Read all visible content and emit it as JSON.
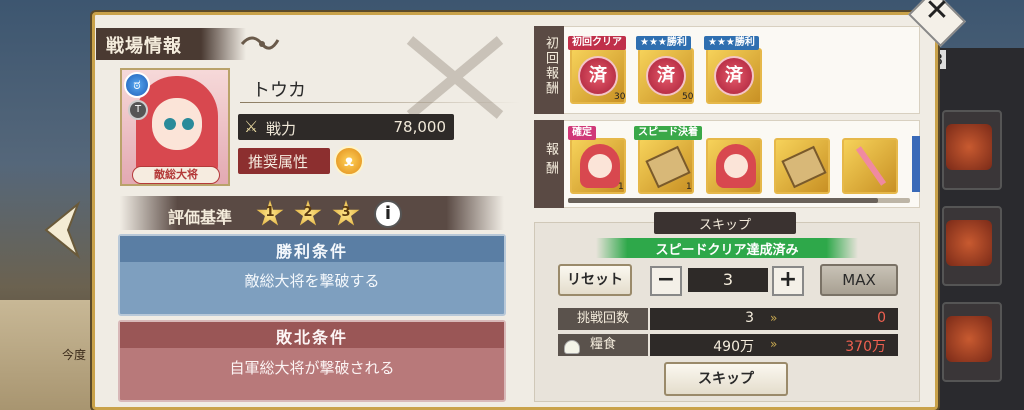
{
  "background": {
    "left_text": "今度",
    "right_number": "3"
  },
  "dialog": {
    "title": "戦場情報",
    "close_label": "✕"
  },
  "character": {
    "name": "トウカ",
    "portrait_label": "敵総大将",
    "element_symbol": "ಠ",
    "rank_symbol": "T",
    "power_label": "戦力",
    "power_value": "78,000",
    "recommended_attr_label": "推奨属性",
    "recommended_attr_symbol": "ᴥ"
  },
  "criteria": {
    "label": "評価基準",
    "stars": [
      "1",
      "2",
      "3"
    ],
    "info_label": "i"
  },
  "victory": {
    "title": "勝利条件",
    "description": "敵総大将を撃破する"
  },
  "defeat": {
    "title": "敗北条件",
    "description": "自軍総大将が撃破される"
  },
  "first_clear_rewards": {
    "side_label": "初回報酬",
    "items": [
      {
        "tag": "初回クリア",
        "tag_color": "#c0304a",
        "icon": "claimed-seal-icon",
        "symbol": "済",
        "count": "30"
      },
      {
        "tag": "★★★勝利",
        "tag_color": "#2f6fb0",
        "icon": "claimed-seal-icon",
        "symbol": "済",
        "count": "50"
      },
      {
        "tag": "★★★勝利",
        "tag_color": "#2f6fb0",
        "icon": "claimed-seal-icon",
        "symbol": "済",
        "count": ""
      }
    ]
  },
  "rewards": {
    "side_label": "報酬",
    "items": [
      {
        "tag": "確定",
        "tag_color": "#d03878",
        "icon": "character-card-icon",
        "count": "1"
      },
      {
        "tag": "スピード決着",
        "tag_color": "#3aa848",
        "icon": "scroll-icon",
        "count": "1"
      },
      {
        "tag": "",
        "icon": "character-card-icon",
        "count": ""
      },
      {
        "tag": "",
        "icon": "scroll-icon",
        "count": ""
      },
      {
        "tag": "",
        "icon": "wand-icon",
        "count": ""
      }
    ]
  },
  "skip": {
    "header": "スキップ",
    "speed_status": "スピードクリア達成済み",
    "reset_label": "リセット",
    "minus_label": "−",
    "count": "3",
    "plus_label": "+",
    "max_label": "MAX",
    "challenge_label": "挑戦回数",
    "challenge_current": "3",
    "challenge_after": "0",
    "food_label": "糧食",
    "food_current": "490万",
    "food_after": "370万",
    "arrow_symbol": "»",
    "skip_button_label": "スキップ"
  }
}
